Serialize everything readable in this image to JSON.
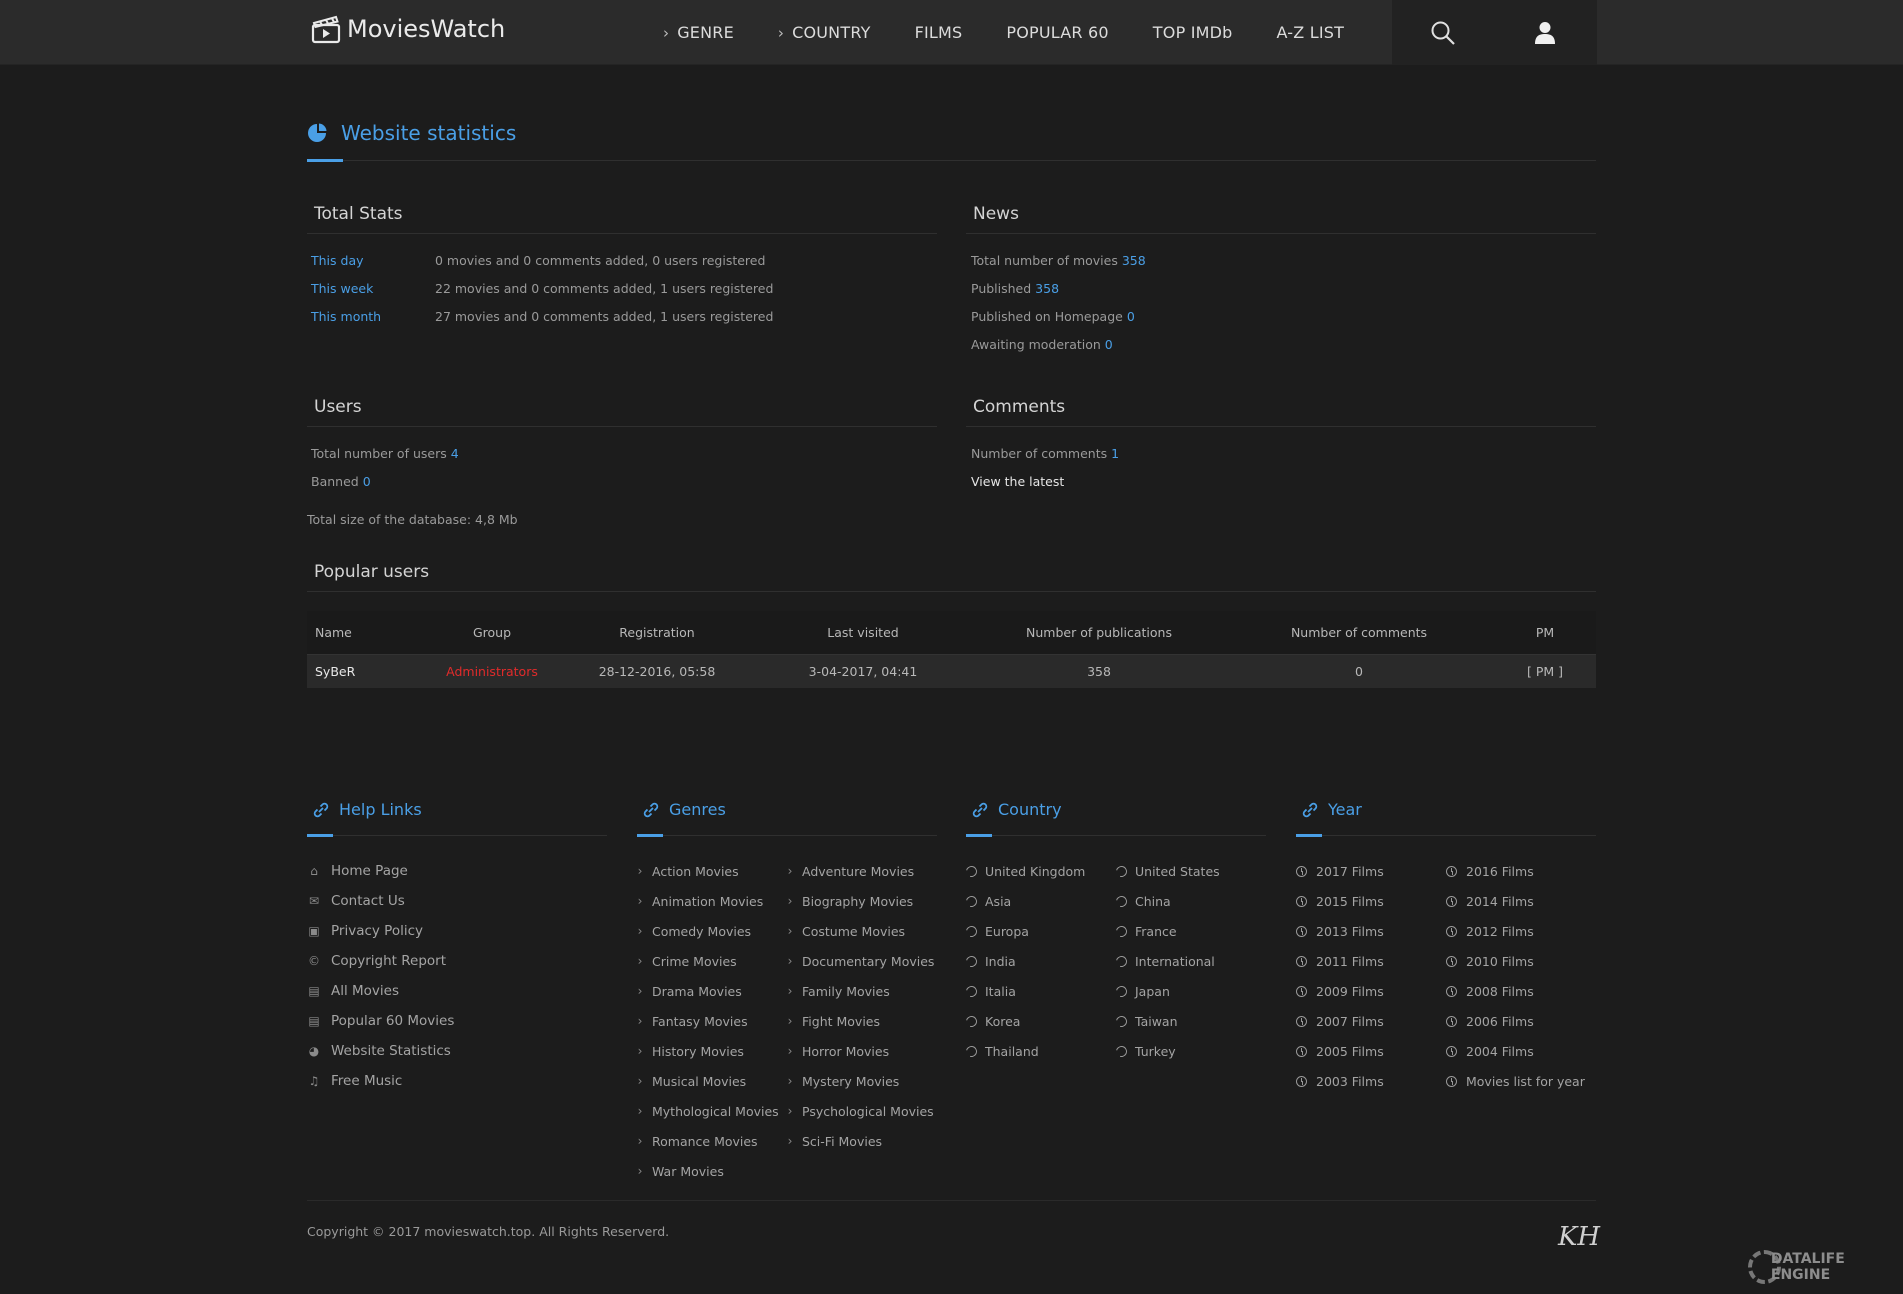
{
  "header": {
    "logo": "MoviesWatch",
    "nav": [
      {
        "label": "GENRE",
        "chevron": true
      },
      {
        "label": "COUNTRY",
        "chevron": true
      },
      {
        "label": "FILMS",
        "chevron": false
      },
      {
        "label": "POPULAR 60",
        "chevron": false
      },
      {
        "label": "TOP IMDb",
        "chevron": false
      },
      {
        "label": "A-Z LIST",
        "chevron": false
      }
    ]
  },
  "page": {
    "title": "Website statistics"
  },
  "total_stats": {
    "heading": "Total Stats",
    "rows": [
      {
        "label": "This day",
        "text": "0 movies and 0 comments added, 0 users registered"
      },
      {
        "label": "This week",
        "text": "22 movies and 0 comments added, 1 users registered"
      },
      {
        "label": "This month",
        "text": "27 movies and 0 comments added, 1 users registered"
      }
    ]
  },
  "news": {
    "heading": "News",
    "rows": [
      {
        "label": "Total number of movies",
        "value": "358"
      },
      {
        "label": "Published",
        "value": "358"
      },
      {
        "label": "Published on Homepage",
        "value": "0"
      },
      {
        "label": "Awaiting moderation",
        "value": "0"
      }
    ]
  },
  "users": {
    "heading": "Users",
    "total_label": "Total number of users",
    "total_value": "4",
    "banned_label": "Banned",
    "banned_value": "0",
    "db_size": "Total size of the database: 4,8 Mb"
  },
  "comments": {
    "heading": "Comments",
    "count_label": "Number of comments",
    "count_value": "1",
    "view_latest": "View the latest"
  },
  "popular_users": {
    "heading": "Popular users",
    "columns": [
      "Name",
      "Group",
      "Registration",
      "Last visited",
      "Number of publications",
      "Number of comments",
      "PM"
    ],
    "rows": [
      {
        "name": "SyBeR",
        "group": "Administrators",
        "registration": "28-12-2016, 05:58",
        "last_visited": "3-04-2017, 04:41",
        "publications": "358",
        "comments": "0",
        "pm": "[ PM ]"
      }
    ]
  },
  "footer": {
    "help_links": {
      "title": "Help Links",
      "items": [
        {
          "label": "Home Page",
          "icon": "home-icon"
        },
        {
          "label": "Contact Us",
          "icon": "envelope-icon"
        },
        {
          "label": "Privacy Policy",
          "icon": "lock-icon"
        },
        {
          "label": "Copyright Report",
          "icon": "copyright-icon"
        },
        {
          "label": "All Movies",
          "icon": "film-icon"
        },
        {
          "label": "Popular 60 Movies",
          "icon": "film-icon"
        },
        {
          "label": "Website Statistics",
          "icon": "pie-chart-icon"
        },
        {
          "label": "Free Music",
          "icon": "music-icon"
        }
      ]
    },
    "genres": {
      "title": "Genres",
      "col1": [
        "Action Movies",
        "Animation Movies",
        "Comedy Movies",
        "Crime Movies",
        "Drama Movies",
        "Fantasy Movies",
        "History Movies",
        "Musical Movies",
        "Mythological Movies",
        "Romance Movies",
        "War Movies"
      ],
      "col2": [
        "Adventure Movies",
        "Biography Movies",
        "Costume Movies",
        "Documentary Movies",
        "Family Movies",
        "Fight Movies",
        "Horror Movies",
        "Mystery Movies",
        "Psychological Movies",
        "Sci-Fi Movies"
      ]
    },
    "country": {
      "title": "Country",
      "col1": [
        "United Kingdom",
        "Asia",
        "Europa",
        "India",
        "Italia",
        "Korea",
        "Thailand"
      ],
      "col2": [
        "United States",
        "China",
        "France",
        "International",
        "Japan",
        "Taiwan",
        "Turkey"
      ]
    },
    "year": {
      "title": "Year",
      "col1": [
        "2017 Films",
        "2015 Films",
        "2013 Films",
        "2011 Films",
        "2009 Films",
        "2007 Films",
        "2005 Films",
        "2003 Films"
      ],
      "col2": [
        "2016 Films",
        "2014 Films",
        "2012 Films",
        "2010 Films",
        "2008 Films",
        "2006 Films",
        "2004 Films",
        "Movies list for year"
      ]
    },
    "copyright": "Copyright © 2017 movieswatch.top. All Rights Reserverd.",
    "signature": "KH",
    "engine": "DATALIFE ENGINE"
  },
  "colors": {
    "accent": "#4a9fe6",
    "admin": "#e02b2b",
    "background": "#1c1c1c",
    "header": "#2b2b2b"
  }
}
